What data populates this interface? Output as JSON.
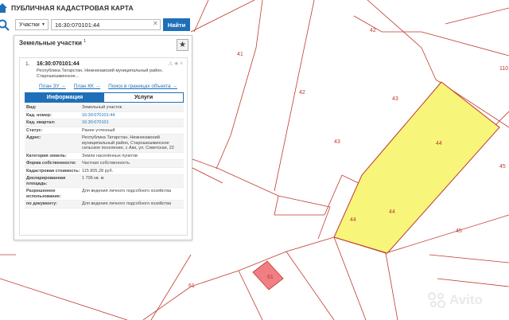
{
  "header": {
    "title": "ПУБЛИЧНАЯ КАДАСТРОВАЯ КАРТА"
  },
  "search": {
    "type_label": "Участки",
    "value": "16:30:070101:44",
    "find_label": "Найти"
  },
  "panel": {
    "title": "Земельные участки",
    "count": "1",
    "result": {
      "index": "1.",
      "cadnum": "16:30:070101:44",
      "address": "Республика Татарстан, Нижнекамский муниципальный район, Старошешминское...",
      "links": [
        "План ЗУ →",
        "План КК →",
        "Поиск в границах объекта →"
      ]
    },
    "tabs": [
      "Информация",
      "Услуги"
    ],
    "info": [
      {
        "key": "Вид:",
        "value": "Земельный участок"
      },
      {
        "key": "Кад. номер:",
        "value": "16:30:070101:44"
      },
      {
        "key": "Кад. квартал:",
        "value": "16:30:070101"
      },
      {
        "key": "Статус:",
        "value": "Ранее учтенный"
      },
      {
        "key": "Адрес:",
        "value": "Республика Татарстан, Нижнекамский муниципальный район, Старошешминское сельское поселение, с Аки, ул. Советская, 22"
      },
      {
        "key": "Категория земель:",
        "value": "Земли населённых пунктов"
      },
      {
        "key": "Форма собственности:",
        "value": "Частная собственность"
      },
      {
        "key": "Кадастровая стоимость:",
        "value": "115 805,28 руб."
      },
      {
        "key": "Декларированная площадь:",
        "value": "1 706 кв. м"
      },
      {
        "key": "Разрешенное использование:",
        "value": "Для ведения личного подсобного хозяйства"
      },
      {
        "key": "по документу:",
        "value": "Для ведения личного подсобного хозяйства"
      }
    ]
  },
  "map": {
    "parcel_numbers": [
      "42",
      "41",
      "110",
      "42",
      "43",
      "43",
      "44",
      "45",
      "44",
      "44",
      "45",
      "61",
      "61"
    ],
    "colors": {
      "boundary": "#c0392b",
      "selected_fill": "#f7f57a",
      "small_parcel_fill": "#ef7f85"
    }
  },
  "watermark": {
    "text": "Avito"
  }
}
